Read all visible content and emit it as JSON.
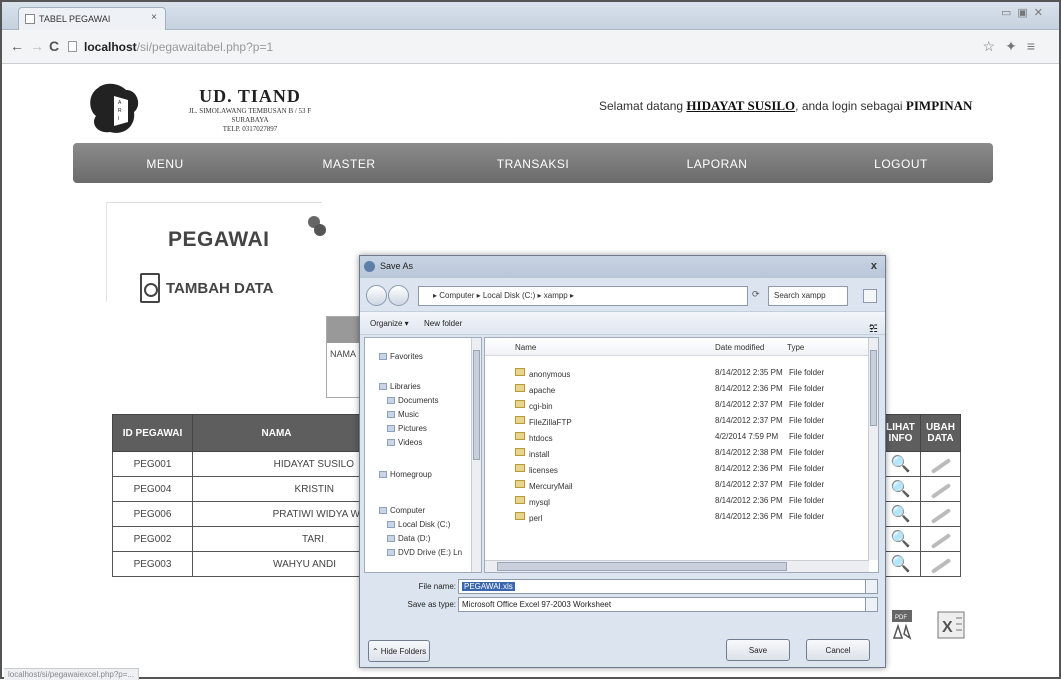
{
  "browser": {
    "tab_title": "TABEL PEGAWAI",
    "tab_close": "×",
    "url_host": "localhost",
    "url_path": "/si/pegawaitabel.php?p=1",
    "status_url": "localhost/si/pegawaiexcel.php?p=..."
  },
  "header": {
    "company_name": "UD. TIAND",
    "company_address": "JL. SIMOLAWANG TEMBUSAN B / 53 F",
    "company_city": "SURABAYA",
    "company_phone": "TELP. 0317027897",
    "welcome_prefix": "Selamat datang",
    "welcome_user": "HIDAYAT SUSILO",
    "welcome_middle": ", anda login sebagai",
    "welcome_role": "PIMPINAN"
  },
  "menu": {
    "items": [
      "MENU",
      "MASTER",
      "TRANSAKSI",
      "LAPORAN",
      "LOGOUT"
    ]
  },
  "page": {
    "title": "PEGAWAI",
    "add_label": "TAMBAH DATA",
    "search_label": "NAMA"
  },
  "table": {
    "headers": [
      "ID PEGAWAI",
      "NAMA"
    ],
    "right_headers": [
      "LIHAT INFO",
      "UBAH DATA"
    ],
    "rows": [
      {
        "id": "PEG001",
        "nama": "HIDAYAT SUSILO"
      },
      {
        "id": "PEG004",
        "nama": "KRISTIN"
      },
      {
        "id": "PEG006",
        "nama": "PRATIWI WIDYA W"
      },
      {
        "id": "PEG002",
        "nama": "TARI"
      },
      {
        "id": "PEG003",
        "nama": "WAHYU ANDI"
      }
    ]
  },
  "dialog": {
    "title": "Save As",
    "close": "x",
    "breadcrumb": "▸ Computer ▸ Local Disk (C:) ▸ xampp ▸",
    "search_placeholder": "Search xampp",
    "organize": "Organize ▾",
    "new_folder": "New folder",
    "nav": {
      "favorites": "Favorites",
      "libraries": "Libraries",
      "documents": "Documents",
      "music": "Music",
      "pictures": "Pictures",
      "videos": "Videos",
      "homegroup": "Homegroup",
      "computer": "Computer",
      "local_disk": "Local Disk (C:)",
      "data": "Data (D:)",
      "dvd": "DVD Drive (E:) Ln"
    },
    "columns": {
      "name": "Name",
      "date": "Date modified",
      "type": "Type"
    },
    "files": [
      {
        "name": "anonymous",
        "date": "8/14/2012 2:35 PM",
        "type": "File folder"
      },
      {
        "name": "apache",
        "date": "8/14/2012 2:36 PM",
        "type": "File folder"
      },
      {
        "name": "cgi-bin",
        "date": "8/14/2012 2:37 PM",
        "type": "File folder"
      },
      {
        "name": "FileZillaFTP",
        "date": "8/14/2012 2:37 PM",
        "type": "File folder"
      },
      {
        "name": "htdocs",
        "date": "4/2/2014 7:59 PM",
        "type": "File folder"
      },
      {
        "name": "install",
        "date": "8/14/2012 2:38 PM",
        "type": "File folder"
      },
      {
        "name": "licenses",
        "date": "8/14/2012 2:36 PM",
        "type": "File folder"
      },
      {
        "name": "MercuryMail",
        "date": "8/14/2012 2:37 PM",
        "type": "File folder"
      },
      {
        "name": "mysql",
        "date": "8/14/2012 2:36 PM",
        "type": "File folder"
      },
      {
        "name": "perl",
        "date": "8/14/2012 2:36 PM",
        "type": "File folder"
      }
    ],
    "file_name_label": "File name:",
    "file_name_value": "PEGAWAI.xls",
    "save_type_label": "Save as type:",
    "save_type_value": "Microsoft Office Excel 97-2003 Worksheet",
    "hide_folders": "Hide Folders",
    "save": "Save",
    "cancel": "Cancel"
  }
}
